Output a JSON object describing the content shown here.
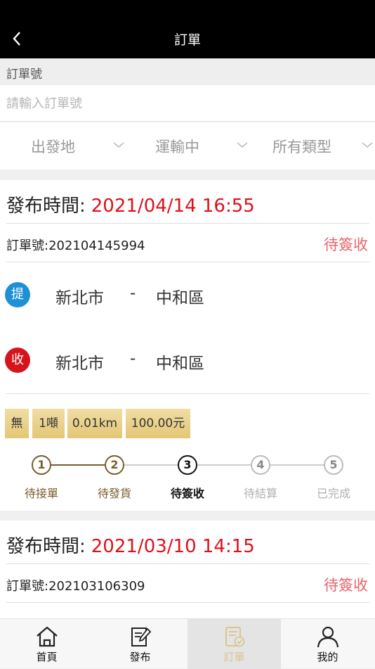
{
  "header": {
    "title": "訂單"
  },
  "section_label": "訂單號",
  "search": {
    "placeholder": "請輸入訂單號",
    "value": ""
  },
  "filters": [
    {
      "label": "出發地"
    },
    {
      "label": "運輸中"
    },
    {
      "label": "所有類型"
    }
  ],
  "orders": [
    {
      "pub_label": "發布時間:",
      "pub_time": "2021/04/14 16:55",
      "order_no": "訂單號:202104145994",
      "status": "待簽收",
      "pickup": {
        "badge": "提",
        "city": "新北市",
        "sep": "-",
        "district": "中和區"
      },
      "delivery": {
        "badge": "收",
        "city": "新北市",
        "sep": "-",
        "district": "中和區"
      },
      "tags": [
        "無",
        "1噸",
        "0.01km",
        "100.00元"
      ],
      "steps": [
        {
          "num": "1",
          "label": "待接單"
        },
        {
          "num": "2",
          "label": "待發貨"
        },
        {
          "num": "3",
          "label": "待簽收"
        },
        {
          "num": "4",
          "label": "待結算"
        },
        {
          "num": "5",
          "label": "已完成"
        }
      ],
      "current_step": 3
    },
    {
      "pub_label": "發布時間:",
      "pub_time": "2021/03/10 14:15",
      "order_no": "訂單號:202103106309",
      "status": "待簽收"
    }
  ],
  "tabbar": [
    {
      "label": "首頁",
      "icon": "home-icon"
    },
    {
      "label": "發布",
      "icon": "edit-icon"
    },
    {
      "label": "訂單",
      "icon": "order-icon",
      "active": true
    },
    {
      "label": "我的",
      "icon": "user-icon"
    }
  ],
  "colors": {
    "accent_gold": "#7a5c2a",
    "date_red": "#e0101a",
    "status_pink": "#e8646a",
    "pickup_blue": "#1e90d6",
    "delivery_red": "#d6141c",
    "tag_gold": "#e8cf86"
  }
}
